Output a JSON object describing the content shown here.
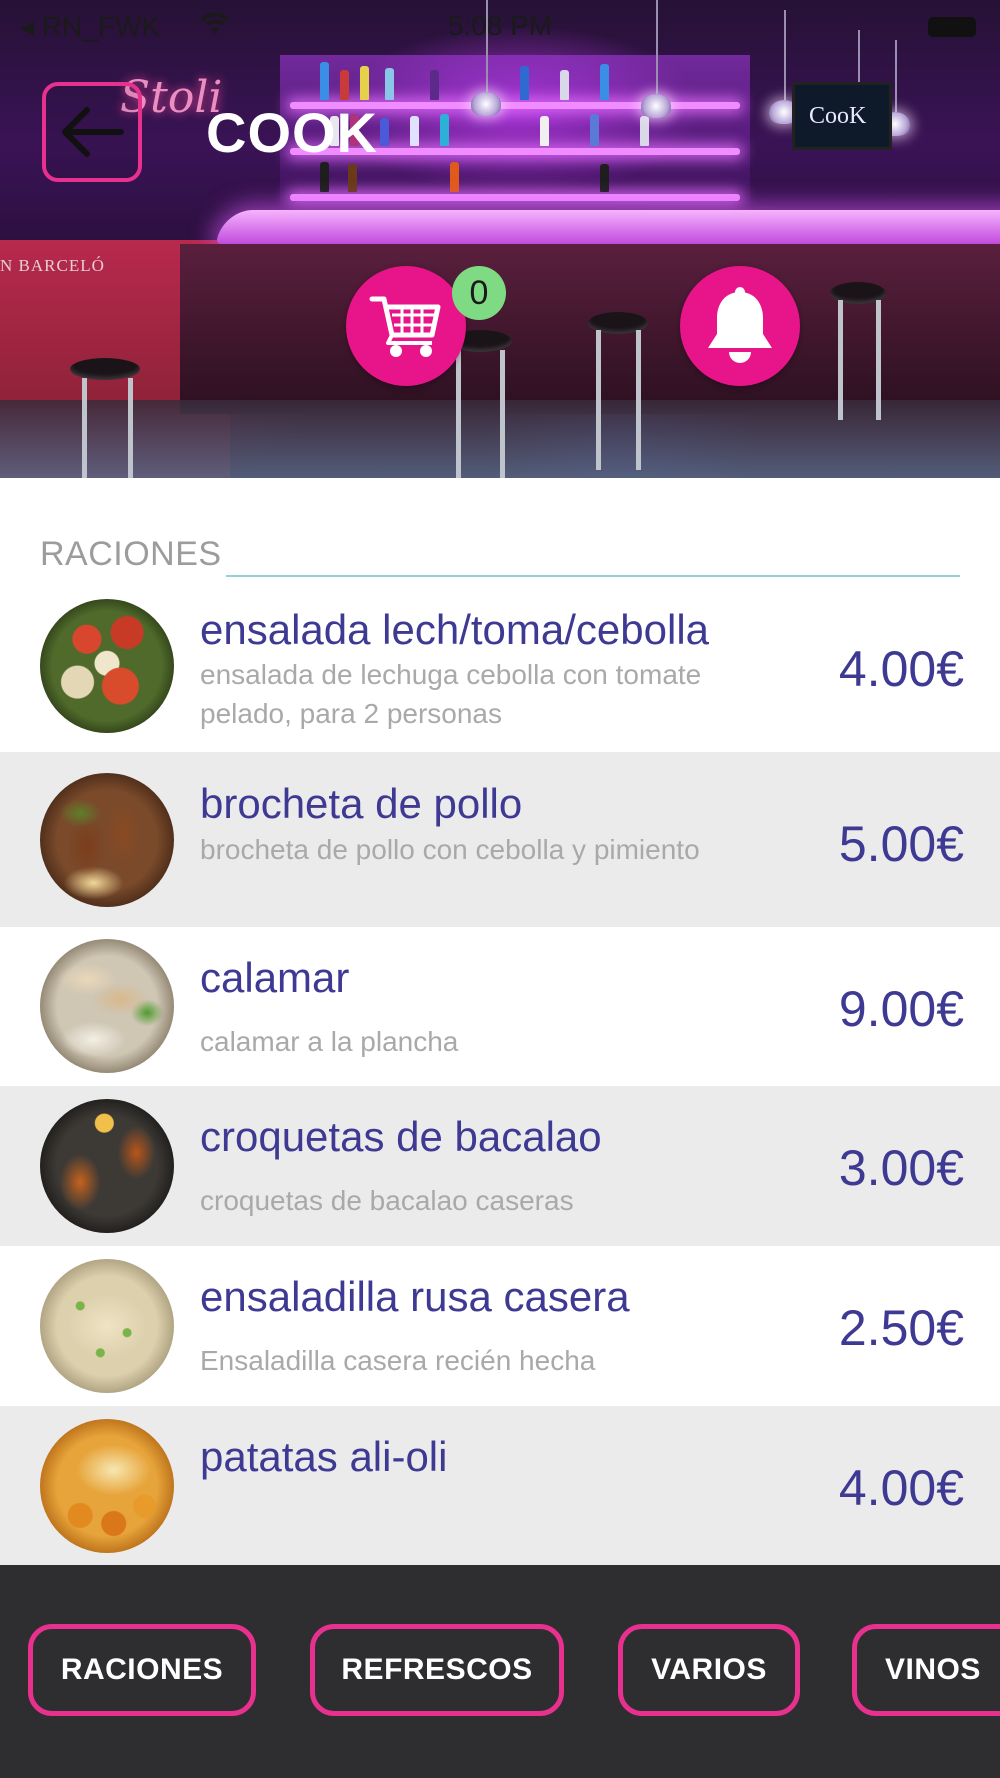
{
  "status_bar": {
    "carrier": "◂ RN_FWK",
    "time": "5:08 PM"
  },
  "header": {
    "title": "COOK",
    "cart_count": "0",
    "back_icon": "arrow-left-icon",
    "cart_icon": "shopping-cart-icon",
    "bell_icon": "bell-icon",
    "accent_color": "#e8158a",
    "badge_color": "#7edb84"
  },
  "section": {
    "title": "RACIONES"
  },
  "menu_items": [
    {
      "name": "ensalada lech/toma/cebolla",
      "description": "ensalada de lechuga cebolla con tomate pelado,  para 2 personas",
      "price": "4.00€"
    },
    {
      "name": "brocheta de pollo",
      "description": "brocheta de pollo con cebolla y pimiento",
      "price": "5.00€"
    },
    {
      "name": "calamar",
      "description": "calamar a la plancha",
      "price": "9.00€"
    },
    {
      "name": "croquetas de bacalao",
      "description": "croquetas de bacalao caseras",
      "price": "3.00€"
    },
    {
      "name": "ensaladilla rusa casera",
      "description": "Ensaladilla casera recién hecha",
      "price": "2.50€"
    },
    {
      "name": "patatas ali-oli",
      "description": "",
      "price": "4.00€"
    }
  ],
  "bottom_nav": {
    "items": [
      "RACIONES",
      "REFRESCOS",
      "VARIOS",
      "VINOS"
    ],
    "border_color": "#e8308f"
  },
  "colors": {
    "item_text": "#3e3993",
    "section_line": "#8fd3d8"
  }
}
